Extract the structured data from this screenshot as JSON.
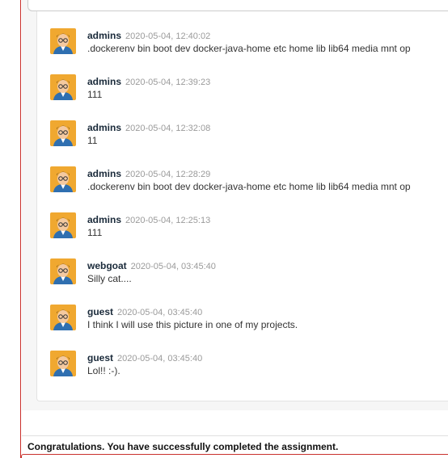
{
  "comments": [
    {
      "user": "admins",
      "timestamp": "2020-05-04, 12:40:02",
      "text": ".dockerenv bin boot dev docker-java-home etc home lib lib64 media mnt op"
    },
    {
      "user": "admins",
      "timestamp": "2020-05-04, 12:39:23",
      "text": "111"
    },
    {
      "user": "admins",
      "timestamp": "2020-05-04, 12:32:08",
      "text": "11"
    },
    {
      "user": "admins",
      "timestamp": "2020-05-04, 12:28:29",
      "text": ".dockerenv bin boot dev docker-java-home etc home lib lib64 media mnt op"
    },
    {
      "user": "admins",
      "timestamp": "2020-05-04, 12:25:13",
      "text": "111"
    },
    {
      "user": "webgoat",
      "timestamp": "2020-05-04, 03:45:40",
      "text": "Silly cat...."
    },
    {
      "user": "guest",
      "timestamp": "2020-05-04, 03:45:40",
      "text": "I think I will use this picture in one of my projects."
    },
    {
      "user": "guest",
      "timestamp": "2020-05-04, 03:45:40",
      "text": "Lol!! :-)."
    }
  ],
  "feedback": {
    "message": "Congratulations. You have successfully completed the assignment."
  },
  "colors": {
    "accent_border": "#c9302c",
    "avatar_bg": "#f0a830",
    "timestamp": "#9a9a9a"
  }
}
